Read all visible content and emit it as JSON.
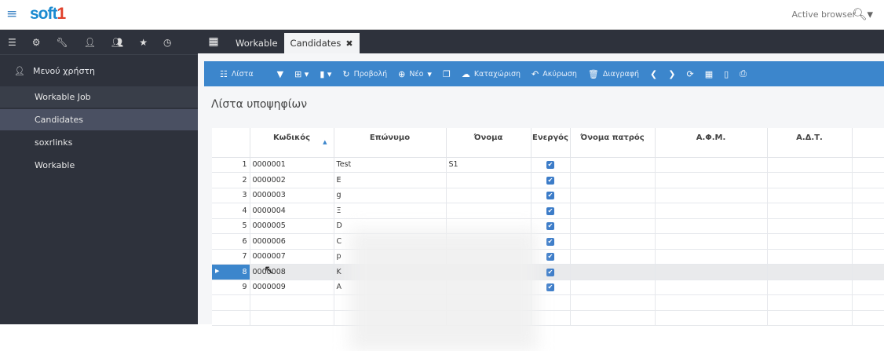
{
  "header": {
    "logo_main": "soft",
    "logo_accent": "1",
    "active_browser": "Active browser"
  },
  "sidebar": {
    "user_menu": "Μενού χρήστη",
    "items": [
      {
        "label": "Workable Job"
      },
      {
        "label": "Candidates"
      },
      {
        "label": "soxrlinks"
      },
      {
        "label": "Workable"
      }
    ]
  },
  "tabs": [
    {
      "label": "Workable"
    },
    {
      "label": "Candidates",
      "close": "✖"
    }
  ],
  "toolbar": {
    "list": "Λίστα",
    "view": "Προβολή",
    "new": "Νέο",
    "save": "Καταχώριση",
    "cancel": "Ακύρωση",
    "delete": "Διαγραφή"
  },
  "page_title": "Λίστα υποψηφίων",
  "table": {
    "columns": [
      "Κωδικός",
      "Επώνυμο",
      "Όνομα",
      "Ενεργός",
      "Όνομα πατρός",
      "Α.Φ.Μ.",
      "Α.Δ.Τ."
    ],
    "rows": [
      {
        "n": "1",
        "code": "0000001",
        "surname": "Test",
        "name": "S1",
        "active": true
      },
      {
        "n": "2",
        "code": "0000002",
        "surname": "E",
        "name": "",
        "active": true
      },
      {
        "n": "3",
        "code": "0000003",
        "surname": "g",
        "name": "",
        "active": true
      },
      {
        "n": "4",
        "code": "0000004",
        "surname": "Ξ",
        "name": "",
        "active": true
      },
      {
        "n": "5",
        "code": "0000005",
        "surname": "D",
        "name": "",
        "active": true
      },
      {
        "n": "6",
        "code": "0000006",
        "surname": "C",
        "name": "",
        "active": true
      },
      {
        "n": "7",
        "code": "0000007",
        "surname": "p",
        "name": "",
        "active": true
      },
      {
        "n": "8",
        "code": "0000008",
        "surname": "K",
        "name": "",
        "active": true,
        "current": true
      },
      {
        "n": "9",
        "code": "0000009",
        "surname": "A",
        "name": "",
        "active": true
      }
    ]
  },
  "colors": {
    "accent": "#3c86cc",
    "sidebar": "#2e323c",
    "logo_blue": "#1a8ad0",
    "logo_red": "#e0402a"
  }
}
